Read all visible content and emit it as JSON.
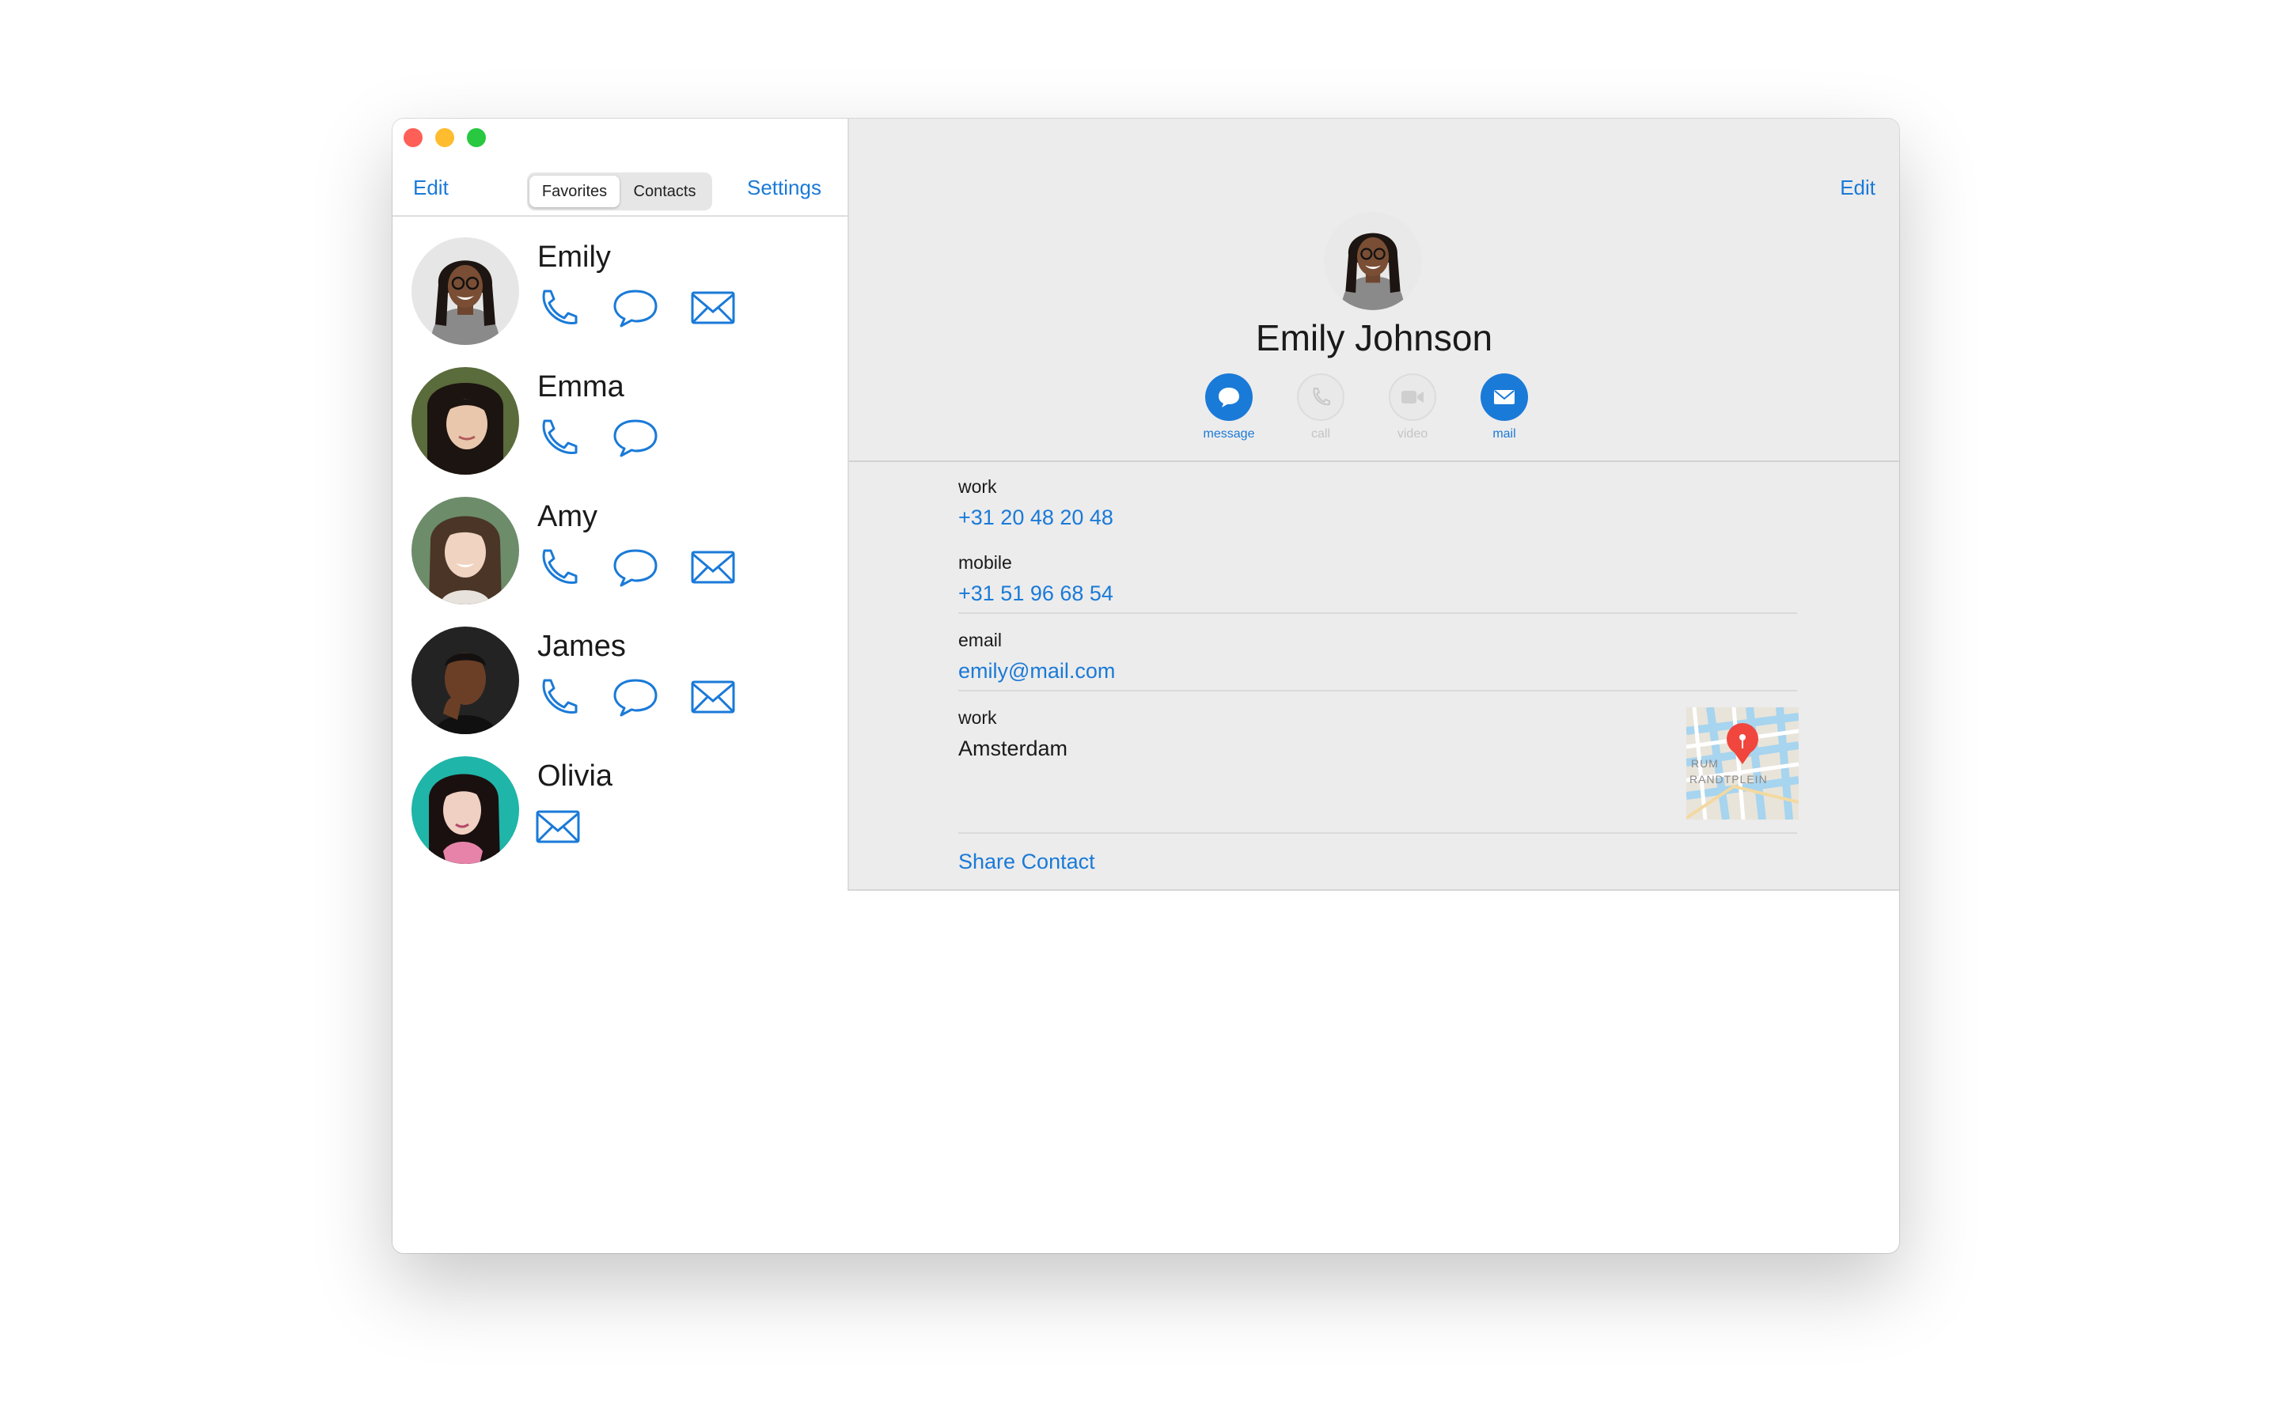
{
  "toolbar": {
    "edit_label": "Edit",
    "settings_label": "Settings"
  },
  "segments": {
    "favorites": "Favorites",
    "contacts": "Contacts",
    "selected": "Favorites"
  },
  "favorites": [
    {
      "name": "Emily",
      "actions": [
        "phone-icon",
        "message-icon",
        "mail-icon"
      ]
    },
    {
      "name": "Emma",
      "actions": [
        "phone-icon",
        "message-icon"
      ]
    },
    {
      "name": "Amy",
      "actions": [
        "phone-icon",
        "message-icon",
        "mail-icon"
      ]
    },
    {
      "name": "James",
      "actions": [
        "phone-icon",
        "message-icon",
        "mail-icon"
      ]
    },
    {
      "name": "Olivia",
      "actions": [
        "mail-icon"
      ]
    }
  ],
  "detail": {
    "edit_label": "Edit",
    "full_name": "Emily Johnson",
    "actions": [
      {
        "label": "message",
        "enabled": true
      },
      {
        "label": "call",
        "enabled": false
      },
      {
        "label": "video",
        "enabled": false
      },
      {
        "label": "mail",
        "enabled": true
      }
    ],
    "fields": [
      {
        "key": "work",
        "value": "+31 20 48 20 48"
      },
      {
        "key": "mobile",
        "value": "+31 51 96 68 54"
      },
      {
        "key": "email",
        "value": "emily@mail.com"
      },
      {
        "key": "work",
        "value": "Amsterdam"
      }
    ],
    "map_label": "RUM\nRANDTPLEIN",
    "share_label": "Share Contact"
  },
  "colors": {
    "accent": "#1a7ad8",
    "detail_bg": "#ececec",
    "disabled": "#c4c4c4"
  }
}
